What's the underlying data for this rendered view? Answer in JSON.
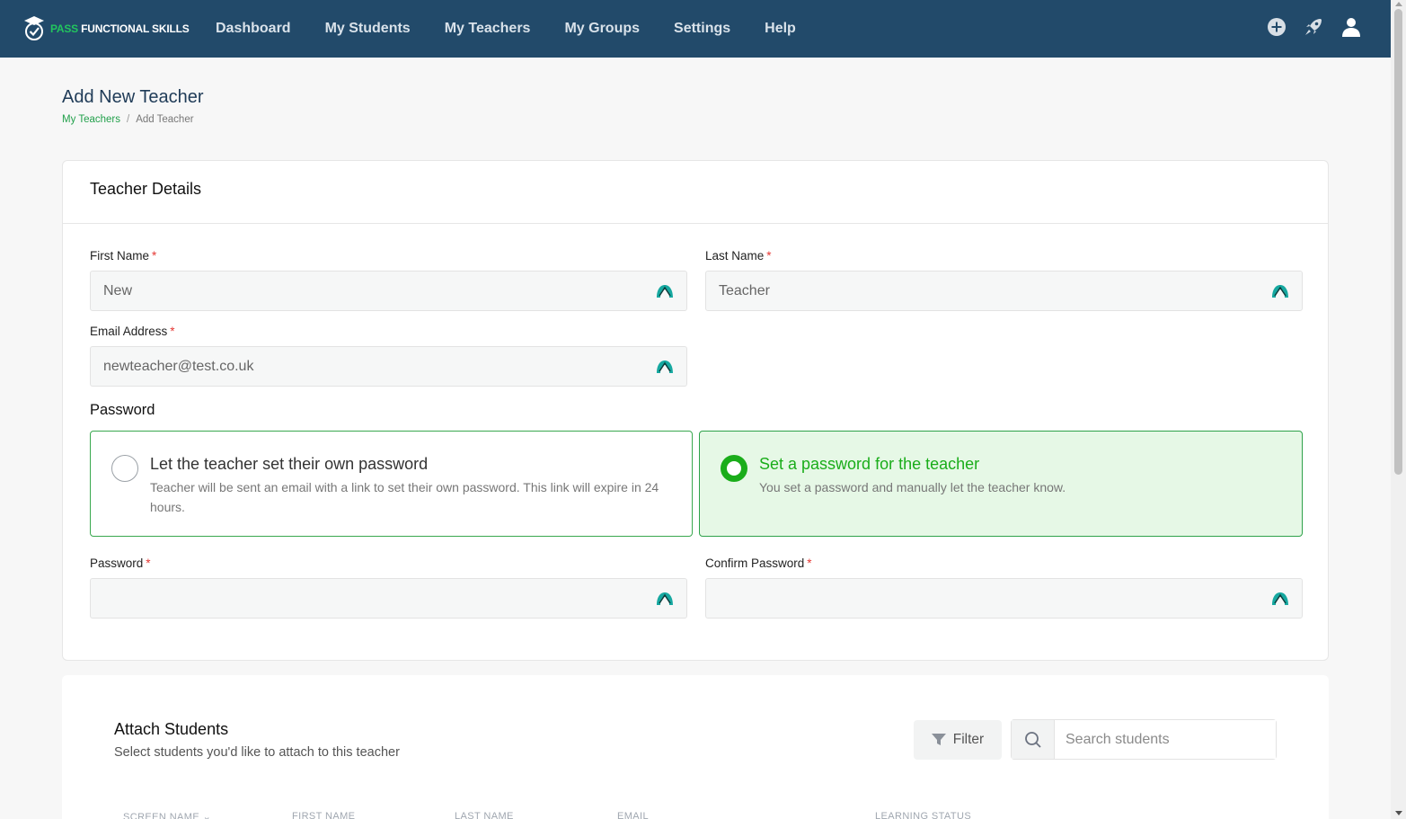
{
  "brand": {
    "part1": "PASS",
    "part2": "FUNCTIONAL SKILLS"
  },
  "nav": [
    "Dashboard",
    "My Students",
    "My Teachers",
    "My Groups",
    "Settings",
    "Help"
  ],
  "nav_icons": [
    "add-icon",
    "rocket-icon",
    "user-icon"
  ],
  "page": {
    "title": "Add New Teacher",
    "breadcrumb": {
      "parent": "My Teachers",
      "separator": "/",
      "current": "Add Teacher"
    }
  },
  "form": {
    "card_title": "Teacher Details",
    "first_name": {
      "label": "First Name",
      "required": "*",
      "value": "New"
    },
    "last_name": {
      "label": "Last Name",
      "required": "*",
      "value": "Teacher"
    },
    "email": {
      "label": "Email Address",
      "required": "*",
      "value": "newteacher@test.co.uk"
    },
    "password_section": "Password",
    "options": [
      {
        "title": "Let the teacher set their own password",
        "desc": "Teacher will be sent an email with a link to set their own password. This link will expire in 24 hours.",
        "selected": false
      },
      {
        "title": "Set a password for the teacher",
        "desc": "You set a password and manually let the teacher know.",
        "selected": true
      }
    ],
    "password": {
      "label": "Password",
      "required": "*",
      "value": ""
    },
    "confirm_password": {
      "label": "Confirm Password",
      "required": "*",
      "value": ""
    }
  },
  "attach": {
    "title": "Attach Students",
    "subtitle": "Select students you'd like to attach to this teacher",
    "filter_label": "Filter",
    "search_placeholder": "Search students",
    "columns": [
      "SCREEN NAME",
      "FIRST NAME",
      "LAST NAME",
      "EMAIL",
      "LEARNING STATUS"
    ]
  },
  "colors": {
    "nav_bg": "#224a6a",
    "accent_green": "#1aad1a",
    "selected_bg": "#e6f8e6",
    "required": "#e53935"
  }
}
